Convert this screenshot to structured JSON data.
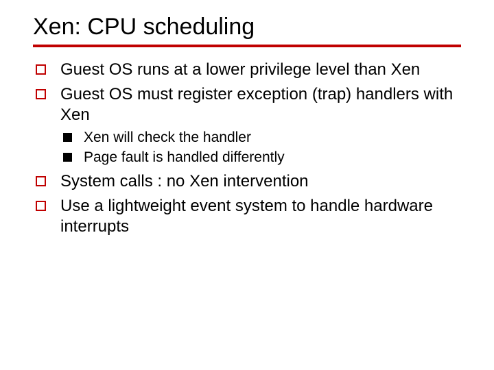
{
  "title": "Xen: CPU scheduling",
  "bullets": {
    "b1": "Guest OS runs at a lower privilege level than Xen",
    "b2": "Guest OS must register exception (trap) handlers with Xen",
    "b2_sub": {
      "s1": "Xen will check the handler",
      "s2": "Page fault is handled differently"
    },
    "b3": "System calls : no Xen intervention",
    "b4": "Use a lightweight event system to handle hardware interrupts"
  }
}
